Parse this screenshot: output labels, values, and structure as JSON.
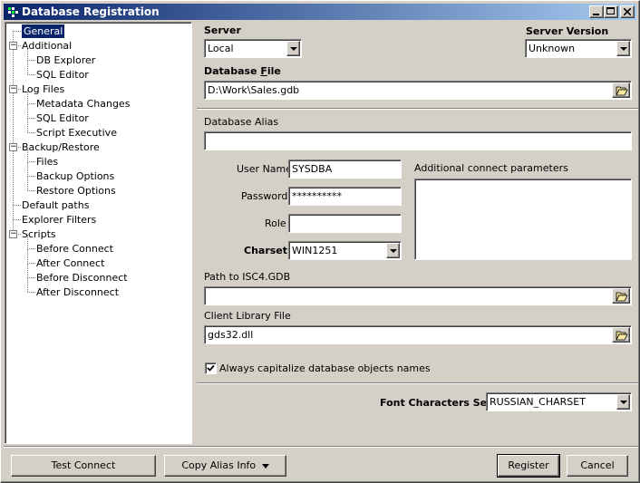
{
  "window": {
    "title": "Database Registration"
  },
  "tree": {
    "nodes": [
      {
        "label": "General",
        "selected": true
      },
      {
        "label": "Additional",
        "expanded": true
      },
      {
        "label": "DB Explorer"
      },
      {
        "label": "SQL Editor"
      },
      {
        "label": "Log Files",
        "expanded": true
      },
      {
        "label": "Metadata Changes"
      },
      {
        "label": "SQL Editor"
      },
      {
        "label": "Script Executive"
      },
      {
        "label": "Backup/Restore",
        "expanded": true
      },
      {
        "label": "Files"
      },
      {
        "label": "Backup Options"
      },
      {
        "label": "Restore Options"
      },
      {
        "label": "Default paths"
      },
      {
        "label": "Explorer Filters"
      },
      {
        "label": "Scripts",
        "expanded": true
      },
      {
        "label": "Before Connect"
      },
      {
        "label": "After Connect"
      },
      {
        "label": "Before Disconnect"
      },
      {
        "label": "After Disconnect"
      }
    ]
  },
  "server": {
    "label": "Server",
    "value": "Local"
  },
  "server_version": {
    "label": "Server Version",
    "value": "Unknown"
  },
  "database_file": {
    "label_pre": "Database ",
    "label_accel": "F",
    "label_post": "ile",
    "value": "D:\\Work\\Sales.gdb"
  },
  "alias": {
    "label": "Database Alias",
    "value": ""
  },
  "user_name": {
    "label": "User Name",
    "value": "SYSDBA"
  },
  "password": {
    "label": "Password",
    "value": "**********"
  },
  "role": {
    "label": "Role",
    "value": ""
  },
  "charset": {
    "label": "Charset",
    "value": "WIN1251"
  },
  "additional_params": {
    "label": "Additional connect parameters",
    "value": ""
  },
  "isc4_path": {
    "label": "Path to ISC4.GDB",
    "value": ""
  },
  "client_library": {
    "label": "Client Library File",
    "value": "gds32.dll"
  },
  "capitalize": {
    "label": "Always capitalize database objects names",
    "checked": true
  },
  "font_charset": {
    "label": "Font Characters Set",
    "value": "RUSSIAN_CHARSET"
  },
  "buttons": {
    "test_connect": "Test Connect",
    "copy_alias": "Copy Alias Info",
    "register": "Register",
    "cancel": "Cancel"
  }
}
